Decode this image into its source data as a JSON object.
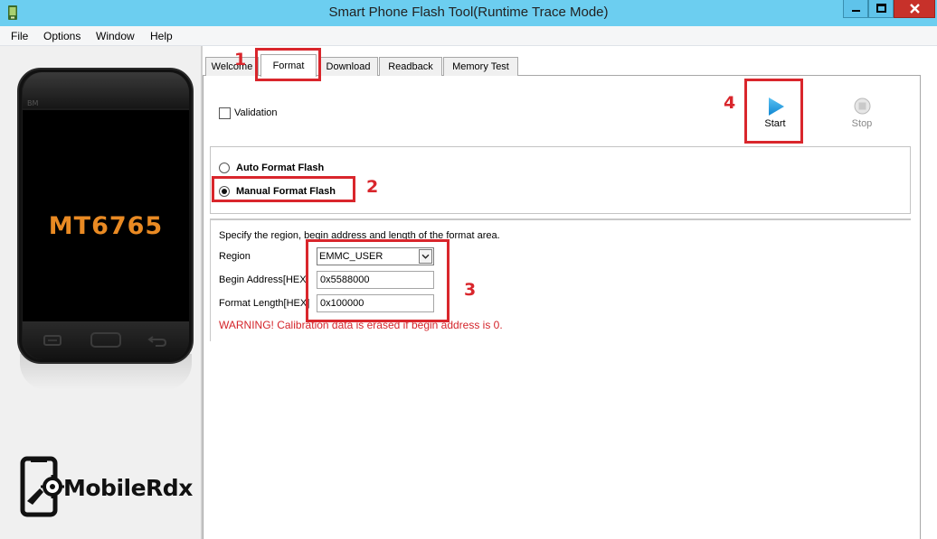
{
  "window": {
    "title": "Smart Phone Flash Tool(Runtime Trace Mode)",
    "controls": [
      "minimize-icon",
      "maximize-icon",
      "close-icon"
    ]
  },
  "menu": {
    "items": [
      "File",
      "Options",
      "Window",
      "Help"
    ]
  },
  "phone": {
    "brand": "BM",
    "chip": "MT6765"
  },
  "logo": {
    "text": "MobileRdx"
  },
  "tabs": [
    {
      "label": "Welcome",
      "active": false
    },
    {
      "label": "Format",
      "active": true
    },
    {
      "label": "Download",
      "active": false
    },
    {
      "label": "Readback",
      "active": false
    },
    {
      "label": "Memory Test",
      "active": false
    }
  ],
  "format": {
    "validation_label": "Validation",
    "validation_checked": false,
    "start_label": "Start",
    "stop_label": "Stop",
    "auto_label": "Auto Format Flash",
    "manual_label": "Manual Format Flash",
    "selected_mode": "manual",
    "instruction": "Specify the region, begin address and length of the format area.",
    "region_label": "Region",
    "region_value": "EMMC_USER",
    "begin_label": "Begin Address[HEX]",
    "begin_value": "0x5588000",
    "length_label": "Format Length[HEX]",
    "length_value": "0x100000",
    "warning": "WARNING! Calibration data is erased if begin address is 0."
  },
  "annotations": {
    "numbers": [
      "1",
      "2",
      "3",
      "4"
    ],
    "color": "#d9262c"
  },
  "colors": {
    "titlebar": "#6ccef0",
    "close_button": "#c7312a",
    "start_icon": "#1e9be0",
    "chip_label": "#e98a23",
    "warning": "#d4242a"
  }
}
